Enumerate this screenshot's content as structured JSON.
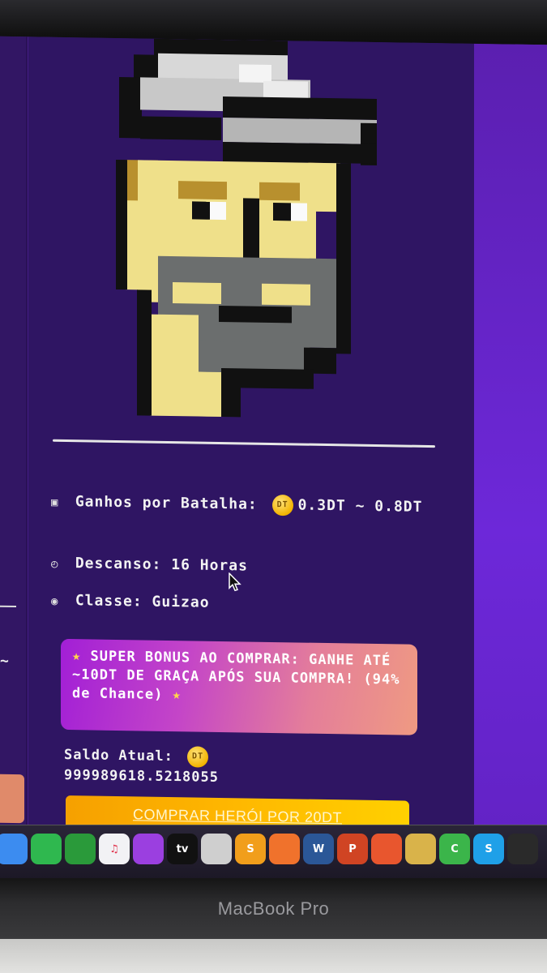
{
  "hero": {
    "ganhos_label": "Ganhos por Batalha:",
    "ganhos_value": "0.3DT ~ 0.8DT",
    "descanso_label": "Descanso:",
    "descanso_value": "16 Horas",
    "classe_label": "Classe:",
    "classe_value": "Guizao"
  },
  "icons": {
    "ganhos": "money-icon",
    "descanso": "clock-icon",
    "classe": "class-icon",
    "coin": "dt-coin-icon",
    "star": "star-icon"
  },
  "coin_label": "DT",
  "bonus": {
    "star": "★",
    "text": "SUPER BONUS AO COMPRAR: GANHE ATÉ ~10DT DE GRAÇA APÓS SUA COMPRA! (94% de Chance)"
  },
  "saldo": {
    "label": "Saldo Atual:",
    "value": "999989618.5218055"
  },
  "buy_button": "COMPRAR HERÓI POR 20DT",
  "left_card_tilde": "~",
  "dock": {
    "items": [
      {
        "name": "finder",
        "label": "",
        "color": "#3c8cf0"
      },
      {
        "name": "messages",
        "label": "",
        "color": "#2fb84f"
      },
      {
        "name": "facetime",
        "label": "",
        "color": "#2a9a3a"
      },
      {
        "name": "music",
        "label": "♫",
        "color": "#f2f2f5"
      },
      {
        "name": "podcasts",
        "label": "",
        "color": "#9b3fe0"
      },
      {
        "name": "apple-tv",
        "label": "tv",
        "color": "#111"
      },
      {
        "name": "preview",
        "label": "",
        "color": "#cfcfcf"
      },
      {
        "name": "sublime",
        "label": "S",
        "color": "#f19e1b"
      },
      {
        "name": "books",
        "label": "",
        "color": "#f0722c"
      },
      {
        "name": "word",
        "label": "W",
        "color": "#2b5797"
      },
      {
        "name": "powerpoint",
        "label": "P",
        "color": "#d04423"
      },
      {
        "name": "safari",
        "label": "",
        "color": "#e8562e"
      },
      {
        "name": "archive",
        "label": "",
        "color": "#d9b34a"
      },
      {
        "name": "camtasia",
        "label": "C",
        "color": "#3bb54a"
      },
      {
        "name": "skype",
        "label": "S",
        "color": "#1fa0e8"
      },
      {
        "name": "devtools",
        "label": "",
        "color": "#2a2a2a"
      }
    ]
  },
  "brand": "MacBook Pro"
}
